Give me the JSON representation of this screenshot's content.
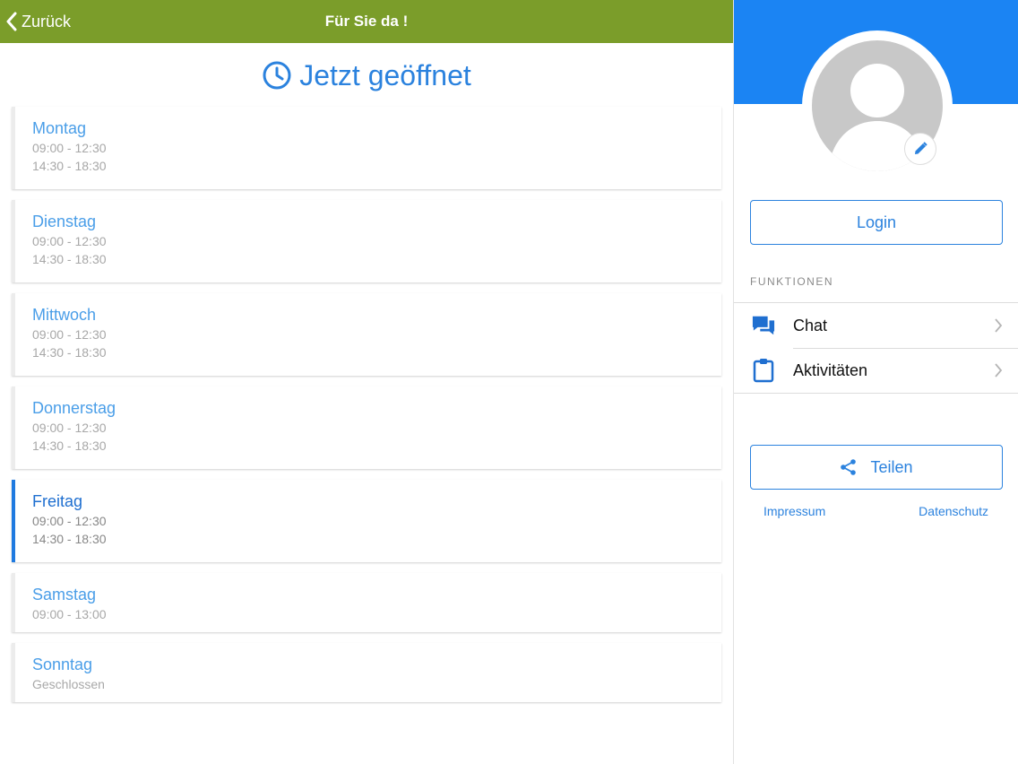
{
  "header": {
    "back_label": "Zurück",
    "title": "Für Sie da !"
  },
  "status": {
    "text": "Jetzt geöffnet",
    "icon": "clock-icon"
  },
  "days": [
    {
      "name": "Montag",
      "times": [
        "09:00 - 12:30",
        "14:30 - 18:30"
      ]
    },
    {
      "name": "Dienstag",
      "times": [
        "09:00 - 12:30",
        "14:30 - 18:30"
      ]
    },
    {
      "name": "Mittwoch",
      "times": [
        "09:00 - 12:30",
        "14:30 - 18:30"
      ]
    },
    {
      "name": "Donnerstag",
      "times": [
        "09:00 - 12:30",
        "14:30 - 18:30"
      ]
    },
    {
      "name": "Freitag",
      "times": [
        "09:00 - 12:30",
        "14:30 - 18:30"
      ],
      "active": true
    },
    {
      "name": "Samstag",
      "times": [
        "09:00 - 13:00"
      ]
    },
    {
      "name": "Sonntag",
      "times": [
        "Geschlossen"
      ]
    }
  ],
  "sidebar": {
    "login_label": "Login",
    "section_label": "FUNKTIONEN",
    "menu": [
      {
        "label": "Chat",
        "icon": "chat-icon"
      },
      {
        "label": "Aktivitäten",
        "icon": "clipboard-icon"
      }
    ],
    "share_label": "Teilen",
    "impressum_label": "Impressum",
    "datenschutz_label": "Datenschutz"
  },
  "colors": {
    "topbar": "#7b9d2a",
    "accent": "#2b82de",
    "sidebar_header": "#1b84f3",
    "active_day": "#1f7ae0"
  }
}
